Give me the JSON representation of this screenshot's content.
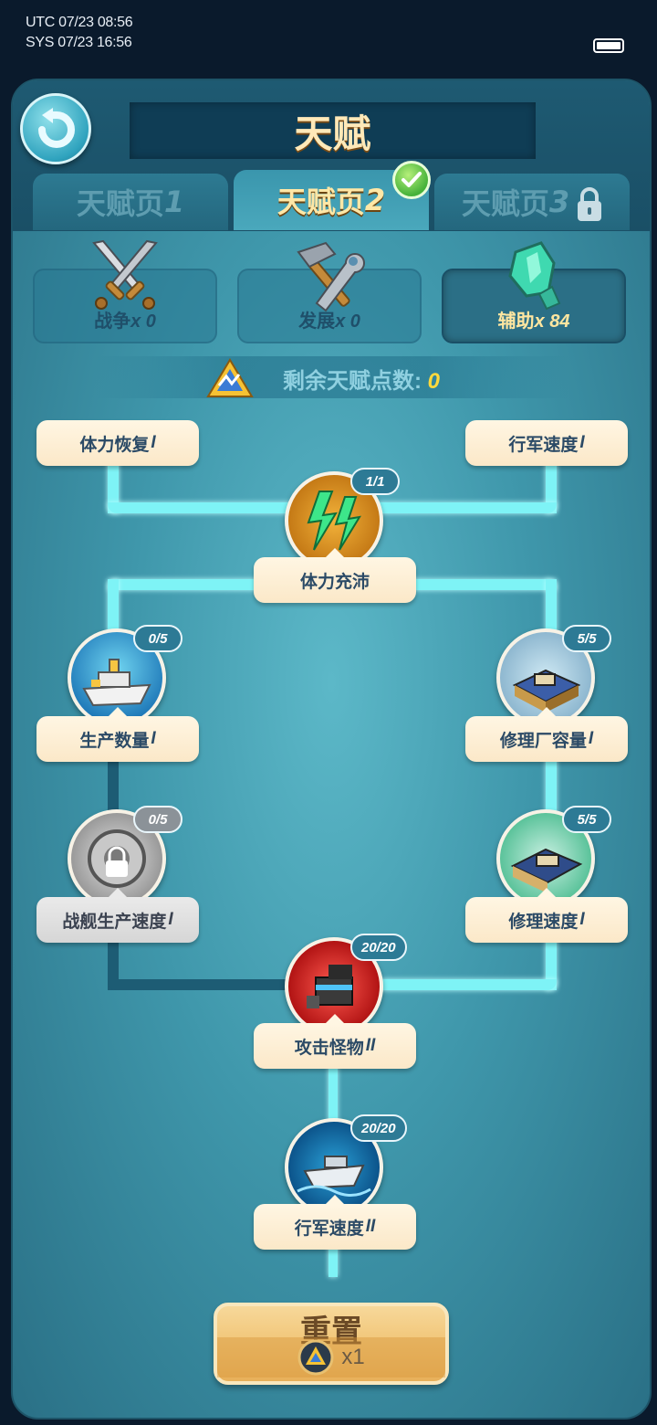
{
  "status": {
    "utc": "UTC 07/23 08:56",
    "sys": "SYS 07/23 16:56"
  },
  "header": {
    "title": "天赋"
  },
  "tabs": [
    {
      "label": "天赋页",
      "num": "1",
      "state": "inactive"
    },
    {
      "label": "天赋页",
      "num": "2",
      "state": "active"
    },
    {
      "label": "天赋页",
      "num": "3",
      "state": "locked"
    }
  ],
  "categories": [
    {
      "label": "战争",
      "count": "x 0",
      "icon": "crossed-swords-icon"
    },
    {
      "label": "发展",
      "count": "x 0",
      "icon": "hammer-wrench-icon"
    },
    {
      "label": "辅助",
      "count": "x 84",
      "icon": "green-crystal-icon",
      "selected": true
    }
  ],
  "points": {
    "label": "剩余天赋点数:",
    "value": "0"
  },
  "tree": {
    "stamina_recovery": {
      "label": "体力恢复",
      "level": "I"
    },
    "march_speed_1": {
      "label": "行军速度",
      "level": "I"
    },
    "full_stamina": {
      "label": "体力充沛",
      "progress": "1/1"
    },
    "production_qty": {
      "label": "生产数量",
      "level": "I",
      "progress": "0/5"
    },
    "repair_capacity": {
      "label": "修理厂容量",
      "level": "I",
      "progress": "5/5"
    },
    "warship_prod_speed": {
      "label": "战舰生产速度",
      "level": "I",
      "progress": "0/5",
      "locked": true
    },
    "repair_speed": {
      "label": "修理速度",
      "level": "I",
      "progress": "5/5"
    },
    "attack_monster": {
      "label": "攻击怪物",
      "level": "II",
      "progress": "20/20"
    },
    "march_speed_2": {
      "label": "行军速度",
      "level": "II",
      "progress": "20/20"
    }
  },
  "reset": {
    "label": "重置",
    "cost": "x1"
  },
  "colors": {
    "accent_line": "#7ef3f6",
    "pill": "#fff6e3",
    "gold_text": "#ffe7a6",
    "points_value": "#ffd93d"
  }
}
